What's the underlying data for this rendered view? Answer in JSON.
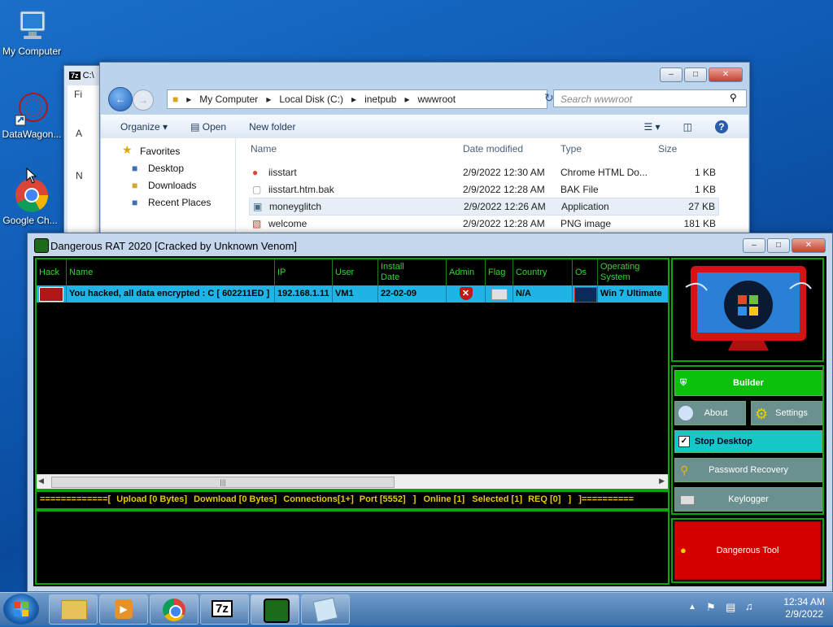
{
  "desktop": {
    "icons": [
      {
        "label": "My Computer"
      },
      {
        "label": "DataWagon..."
      },
      {
        "label": "Google Ch..."
      }
    ]
  },
  "back_windows": {
    "title_fragment": "C:\\",
    "frag1": "Fi",
    "frag2": "A",
    "frag3": "N"
  },
  "explorer": {
    "breadcrumb": [
      "My Computer",
      "Local Disk (C:)",
      "inetpub",
      "wwwroot"
    ],
    "search_placeholder": "Search wwwroot",
    "toolbar": {
      "organize": "Organize",
      "open": "Open",
      "new_folder": "New folder"
    },
    "nav": {
      "favorites": "Favorites",
      "desktop": "Desktop",
      "downloads": "Downloads",
      "recent": "Recent Places"
    },
    "columns": {
      "name": "Name",
      "date": "Date modified",
      "type": "Type",
      "size": "Size"
    },
    "files": [
      {
        "name": "iisstart",
        "date": "2/9/2022 12:30 AM",
        "type": "Chrome HTML Do...",
        "size": "1 KB",
        "icon": "chrome-icon"
      },
      {
        "name": "iisstart.htm.bak",
        "date": "2/9/2022 12:28 AM",
        "type": "BAK File",
        "size": "1 KB",
        "icon": "file-icon"
      },
      {
        "name": "moneyglitch",
        "date": "2/9/2022 12:26 AM",
        "type": "Application",
        "size": "27 KB",
        "icon": "app-icon"
      },
      {
        "name": "welcome",
        "date": "2/9/2022 12:28 AM",
        "type": "PNG image",
        "size": "181 KB",
        "icon": "image-icon"
      }
    ]
  },
  "rat": {
    "title": "Dangerous RAT 2020 [Cracked by Unknown Venom]",
    "columns": [
      "Hack",
      "Name",
      "IP",
      "User",
      "Install Date",
      "Admin",
      "Flag",
      "Country",
      "Os",
      "Operating System"
    ],
    "row": {
      "name": "You hacked, all data encrypted : C [ 602211ED ]",
      "ip": "192.168.1.11",
      "user": "VM1",
      "install_date": "22-02-09",
      "country": "N/A",
      "os_name": "Win 7 Ultimate"
    },
    "status": {
      "dashes": "=============[",
      "upload": "Upload [0 Bytes]",
      "download": "Download [0 Bytes]",
      "connections": "Connections[1+]",
      "port": "Port [5552]",
      "sep1": "]",
      "online": "Online [1]",
      "selected": "Selected [1]",
      "req": "REQ [0]",
      "sep2": "]",
      "tail": "]=========="
    },
    "buttons": {
      "builder": "Builder",
      "about": "About",
      "settings": "Settings",
      "stop_desktop": "Stop Desktop",
      "password_recovery": "Password Recovery",
      "keylogger": "Keylogger",
      "dangerous_tool": "Dangerous Tool"
    },
    "colors": {
      "accent_green": "#08a808",
      "row_blue": "#1fb4e6",
      "status_yellow": "#e4c800",
      "danger_red": "#d40000"
    }
  },
  "taskbar": {
    "time": "12:34 AM",
    "date": "2/9/2022",
    "sevenzip": "7z"
  }
}
